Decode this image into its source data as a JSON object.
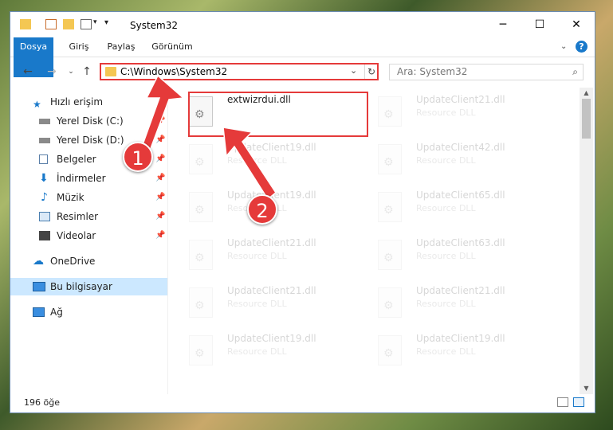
{
  "window": {
    "title": "System32"
  },
  "ribbon": {
    "tabs": [
      "Dosya",
      "Giriş",
      "Paylaş",
      "Görünüm"
    ],
    "help": "?"
  },
  "address": {
    "path": "C:\\Windows\\System32",
    "dropdown": "⌄",
    "refresh": "↻"
  },
  "search": {
    "placeholder": "Ara: System32"
  },
  "sidebar": {
    "items": [
      {
        "label": "Hızlı erişim",
        "icon": "star-icon"
      },
      {
        "label": "Yerel Disk (C:)",
        "icon": "drive-icon",
        "pinned": true
      },
      {
        "label": "Yerel Disk (D:)",
        "icon": "drive-icon",
        "pinned": true
      },
      {
        "label": "Belgeler",
        "icon": "documents-icon",
        "pinned": true
      },
      {
        "label": "İndirmeler",
        "icon": "download-icon",
        "pinned": true
      },
      {
        "label": "Müzik",
        "icon": "music-icon",
        "pinned": true
      },
      {
        "label": "Resimler",
        "icon": "pictures-icon",
        "pinned": true
      },
      {
        "label": "Videolar",
        "icon": "videos-icon",
        "pinned": true
      },
      {
        "label": "OneDrive",
        "icon": "cloud-icon"
      },
      {
        "label": "Bu bilgisayar",
        "icon": "computer-icon",
        "selected": true
      },
      {
        "label": "Ağ",
        "icon": "network-icon"
      }
    ]
  },
  "files": {
    "highlighted": {
      "name": "extwizrdui.dll"
    },
    "left_column": [
      {
        "name": "UpdateClient19.dll",
        "type": "Resource DLL"
      },
      {
        "name": "UpdateClient19.dll",
        "type": "Resource DLL"
      },
      {
        "name": "UpdateClient21.dll",
        "type": "Resource DLL"
      },
      {
        "name": "UpdateClient21.dll",
        "type": "Resource DLL"
      },
      {
        "name": "UpdateClient19.dll",
        "type": "Resource DLL"
      }
    ],
    "right_column": [
      {
        "name": "UpdateClient21.dll",
        "type": "Resource DLL"
      },
      {
        "name": "UpdateClient42.dll",
        "type": "Resource DLL"
      },
      {
        "name": "UpdateClient65.dll",
        "type": "Resource DLL"
      },
      {
        "name": "UpdateClient63.dll",
        "type": "Resource DLL"
      },
      {
        "name": "UpdateClient21.dll",
        "type": "Resource DLL"
      },
      {
        "name": "UpdateClient19.dll",
        "type": "Resource DLL"
      }
    ]
  },
  "status": {
    "count": "196 öğe"
  },
  "markers": {
    "one": "1",
    "two": "2"
  },
  "colors": {
    "accent": "#1979ca",
    "highlight": "#e53a3a",
    "selected": "#cce8ff"
  }
}
